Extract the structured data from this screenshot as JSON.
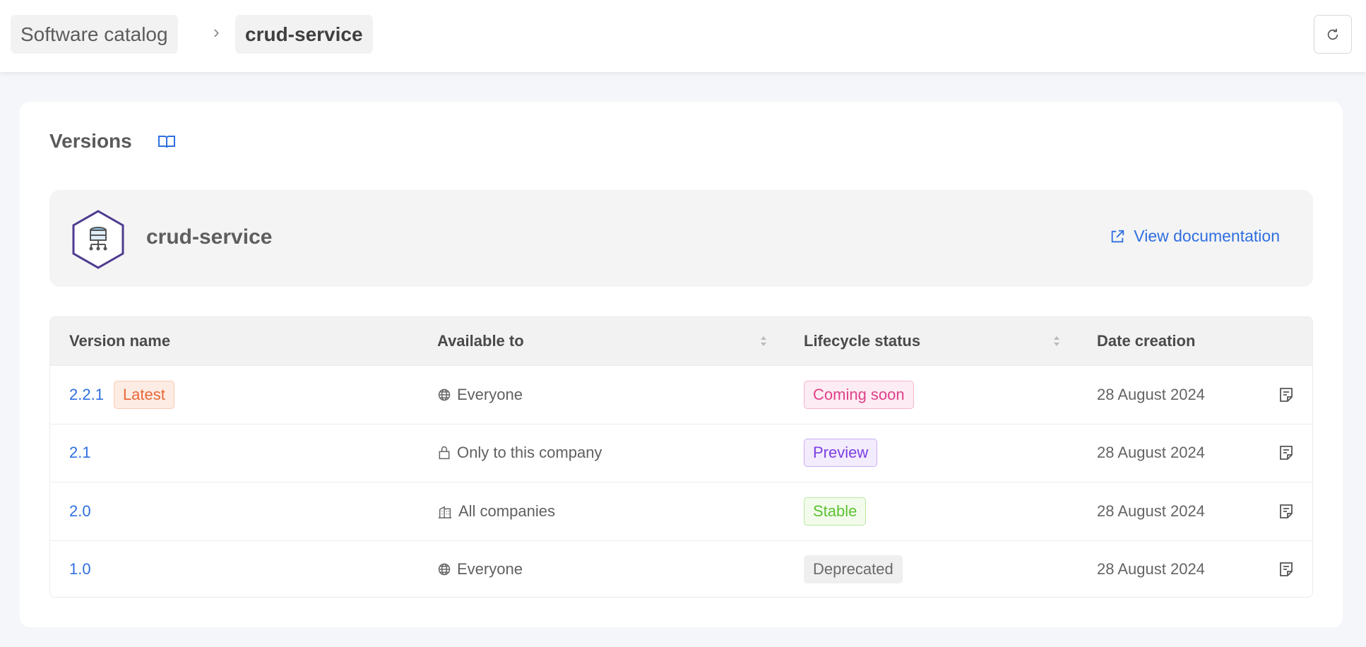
{
  "breadcrumb": {
    "items": [
      "Software catalog",
      "crud-service"
    ]
  },
  "header": {
    "refresh_icon": "refresh-icon"
  },
  "section": {
    "title": "Versions",
    "help_icon": "book-icon"
  },
  "service": {
    "name": "crud-service",
    "doc_link": "View documentation"
  },
  "table": {
    "columns": [
      "Version name",
      "Available to",
      "Lifecycle status",
      "Date creation"
    ],
    "rows": [
      {
        "version": "2.2.1",
        "tag": "Latest",
        "available": "Everyone",
        "available_icon": "globe-icon",
        "status": "Coming soon",
        "status_color": "#e0408a",
        "date": "28 August 2024"
      },
      {
        "version": "2.1",
        "available": "Only to this company",
        "available_icon": "lock-icon",
        "status": "Preview",
        "status_color": "#7a3fe0",
        "date": "28 August 2024"
      },
      {
        "version": "2.0",
        "available": "All companies",
        "available_icon": "building-icon",
        "status": "Stable",
        "status_color": "#5cc232",
        "date": "28 August 2024"
      },
      {
        "version": "1.0",
        "available": "Everyone",
        "available_icon": "globe-icon",
        "status": "Deprecated",
        "status_color": "#6a6a6a",
        "date": "28 August 2024"
      }
    ]
  },
  "colors": {
    "accent": "#2f6fe0"
  }
}
